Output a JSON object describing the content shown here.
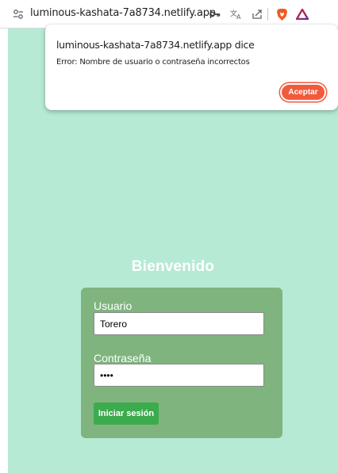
{
  "browser": {
    "url": "luminous-kashata-7a8734.netlify.app",
    "icons": [
      "site-settings-icon",
      "key-icon",
      "translate-icon",
      "share-icon",
      "brave-shields-icon",
      "brave-rewards-icon"
    ]
  },
  "dialog": {
    "title": "luminous-kashata-7a8734.netlify.app dice",
    "message": "Error: Nombre de usuario o contraseña incorrectos",
    "accept_label": "Aceptar"
  },
  "login": {
    "heading": "Bienvenido",
    "username_label": "Usuario",
    "username_value": "Torero",
    "password_label": "Contraseña",
    "password_value": "••••",
    "submit_label": "Iniciar sesión"
  },
  "colors": {
    "page_background": "#b6ead4",
    "card_background": "#7fb47e",
    "submit_button": "#3bab4d",
    "accept_button": "#f15b3c",
    "brave_orange": "#f05a24",
    "rewards_red": "#e2272e"
  }
}
